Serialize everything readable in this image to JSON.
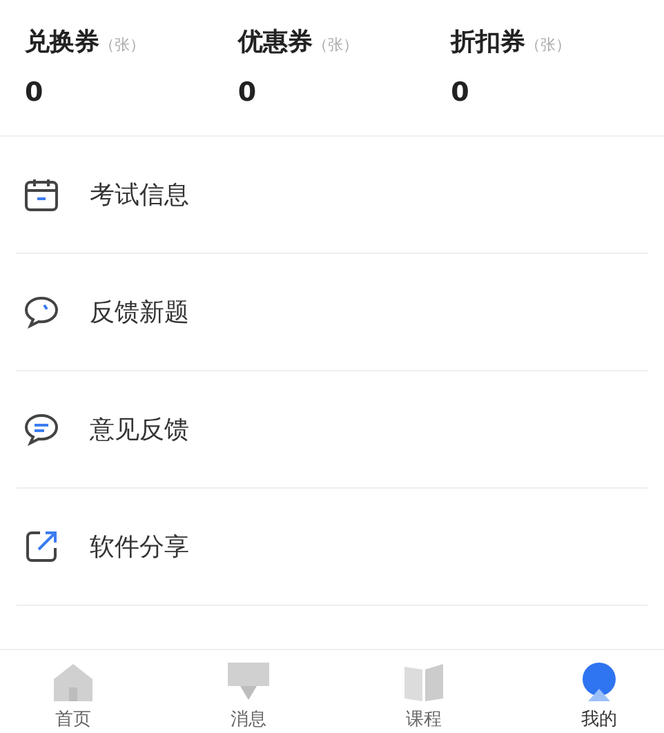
{
  "stats": [
    {
      "label": "兑换券",
      "unit": "（张）",
      "value": "0"
    },
    {
      "label": "优惠券",
      "unit": "（张）",
      "value": "0"
    },
    {
      "label": "折扣券",
      "unit": "（张）",
      "value": "0"
    }
  ],
  "menu": [
    {
      "kind": "calendar",
      "label": "考试信息"
    },
    {
      "kind": "chat",
      "label": "反馈新题"
    },
    {
      "kind": "feedback",
      "label": "意见反馈"
    },
    {
      "kind": "share",
      "label": "软件分享"
    }
  ],
  "tabbar": [
    {
      "kind": "home",
      "label": "首页",
      "selected": false
    },
    {
      "kind": "message",
      "label": "消息",
      "selected": false
    },
    {
      "kind": "course",
      "label": "课程",
      "selected": false
    },
    {
      "kind": "me",
      "label": "我的",
      "selected": true
    }
  ]
}
